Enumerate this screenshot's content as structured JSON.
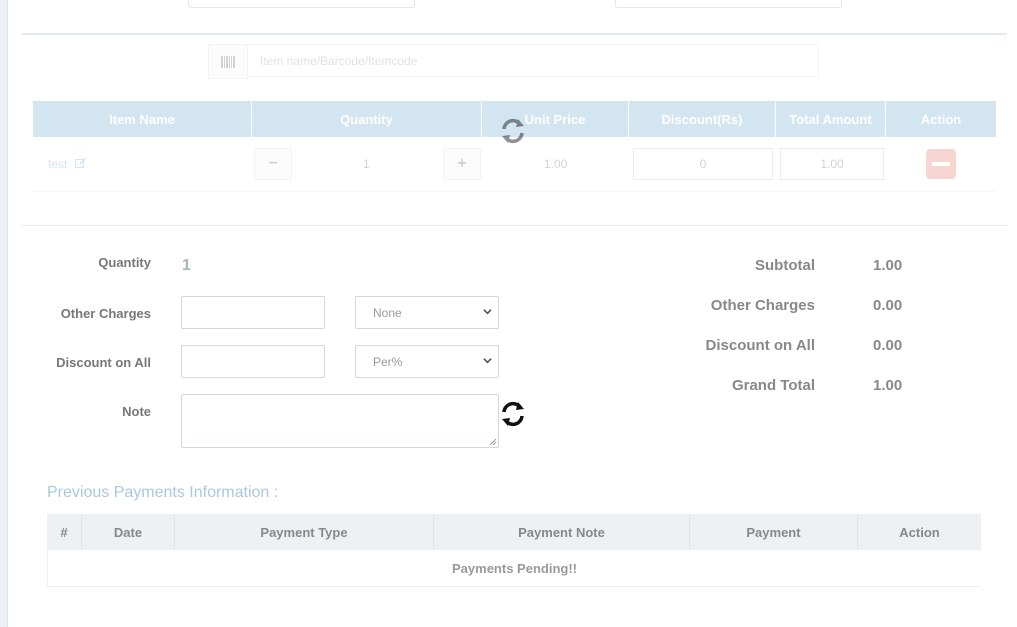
{
  "search": {
    "placeholder": "Item name/Barcode/Itemcode"
  },
  "items_table": {
    "headers": [
      "Item Name",
      "Quantity",
      "Unit Price",
      "Discount(Rs)",
      "Total Amount",
      "Action"
    ],
    "rows": [
      {
        "item_name": "test",
        "quantity": "1",
        "unit_price": "1.00",
        "discount": "0",
        "total_amount": "1.00"
      }
    ],
    "minus_label": "−",
    "plus_label": "+"
  },
  "summary": {
    "quantity_label": "Quantity",
    "quantity_value": "1",
    "other_charges_label": "Other Charges",
    "other_charges_type": "None",
    "discount_label": "Discount on All",
    "discount_type": "Per%",
    "note_label": "Note"
  },
  "totals": {
    "subtotal_label": "Subtotal",
    "subtotal_value": "1.00",
    "other_charges_label": "Other Charges",
    "other_charges_value": "0.00",
    "discount_label": "Discount on All",
    "discount_value": "0.00",
    "grand_total_label": "Grand Total",
    "grand_total_value": "1.00"
  },
  "payments": {
    "title": "Previous Payments Information :",
    "headers": [
      "#",
      "Date",
      "Payment Type",
      "Payment Note",
      "Payment",
      "Action"
    ],
    "empty_text": "Payments Pending!!"
  },
  "icons": {
    "barcode": "barcode-icon",
    "edit": "edit-icon",
    "refresh": "refresh-icon",
    "remove": "remove-icon"
  },
  "colors": {
    "accent": "#3c8dbc",
    "danger": "#dd4b39"
  }
}
